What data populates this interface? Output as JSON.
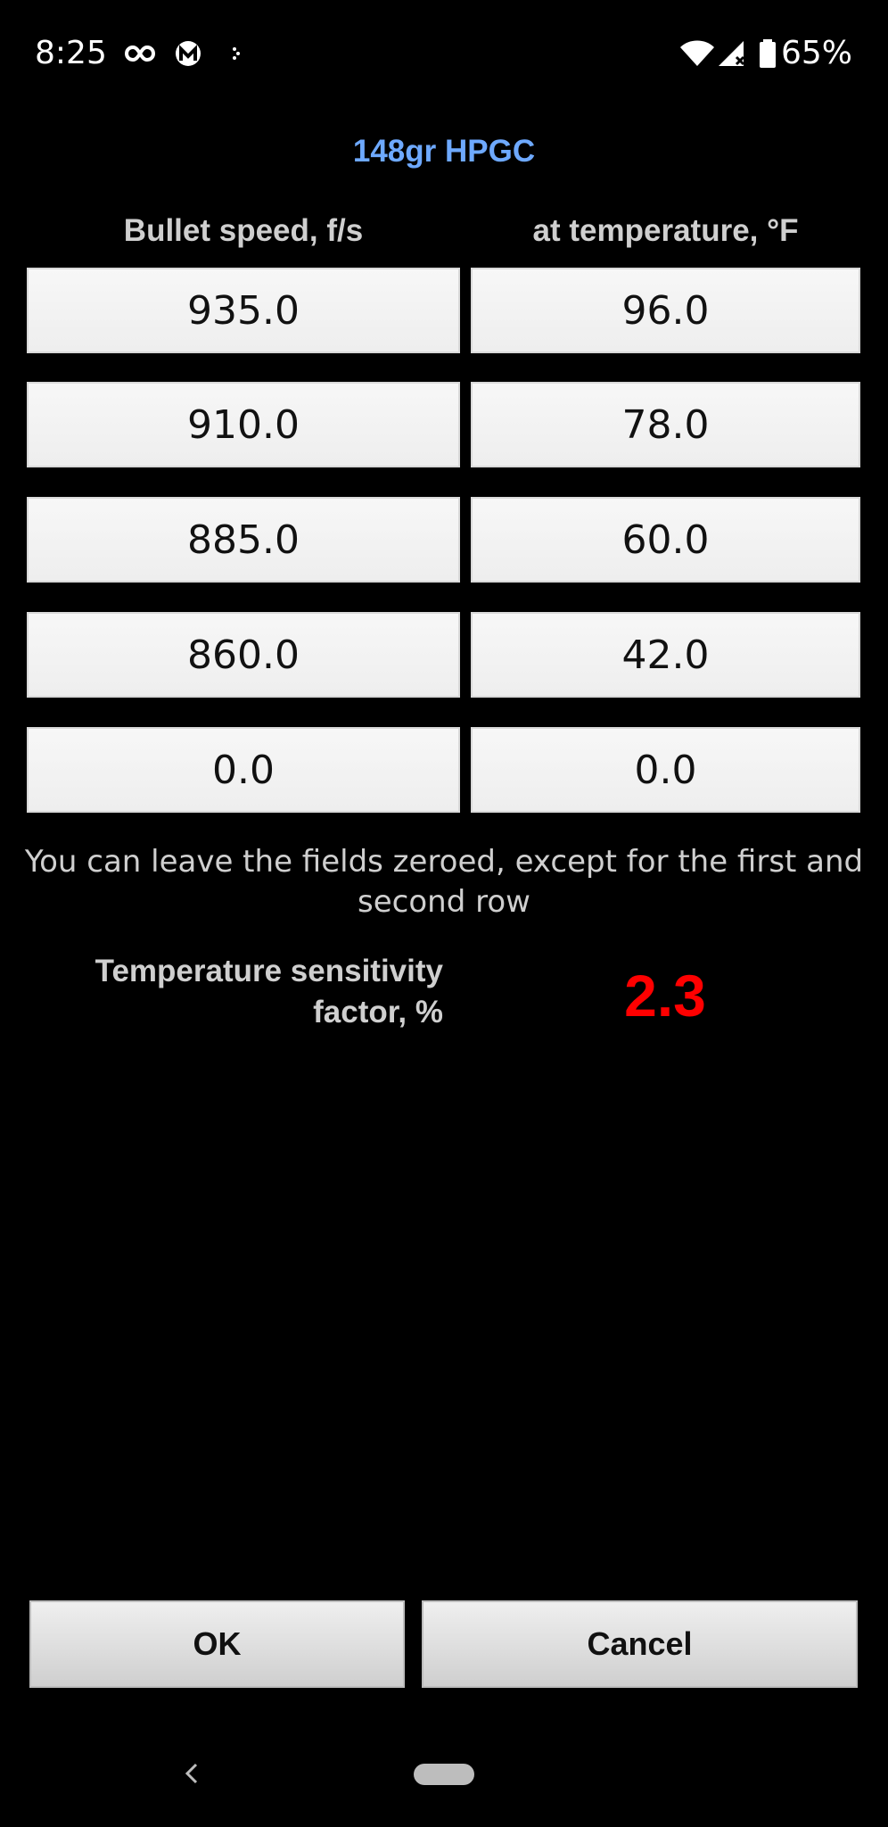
{
  "status_bar": {
    "time": "8:25",
    "battery_percent": "65%",
    "icons": [
      "infinity-icon",
      "malwarebytes-icon",
      "dots-icon",
      "wifi-icon",
      "signal-icon",
      "battery-icon"
    ]
  },
  "dialog": {
    "title": "148gr HPGC",
    "column_headers": {
      "speed": "Bullet speed, f/s",
      "temperature": "at temperature, °F"
    },
    "rows": [
      {
        "speed": "935.0",
        "temperature": "96.0"
      },
      {
        "speed": "910.0",
        "temperature": "78.0"
      },
      {
        "speed": "885.0",
        "temperature": "60.0"
      },
      {
        "speed": "860.0",
        "temperature": "42.0"
      },
      {
        "speed": "0.0",
        "temperature": "0.0"
      }
    ],
    "hint": "You can leave the fields zeroed, except for the first and second row",
    "factor": {
      "label": "Temperature sensitivity factor, %",
      "value": "2.3"
    },
    "buttons": {
      "ok": "OK",
      "cancel": "Cancel"
    }
  },
  "colors": {
    "title": "#6ea9ff",
    "factor_value": "#ff0000",
    "background": "#000000"
  }
}
